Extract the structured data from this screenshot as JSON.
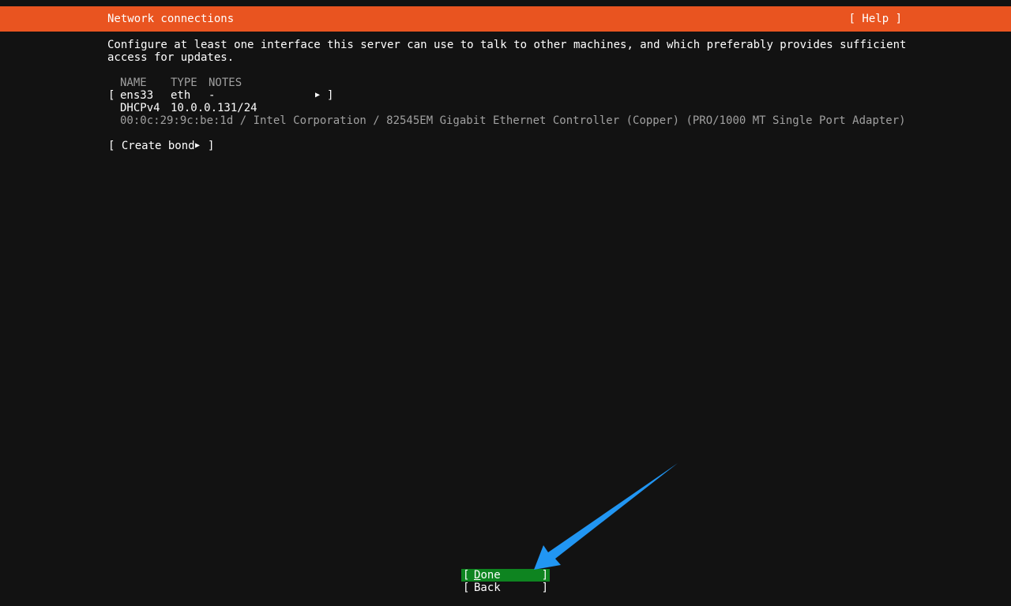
{
  "header": {
    "title": "Network connections",
    "help": "[ Help ]"
  },
  "description": {
    "line1": "Configure at least one interface this server can use to talk to other machines, and which preferably provides sufficient",
    "line2": "access for updates."
  },
  "table": {
    "columns": {
      "name": "NAME",
      "type": "TYPE",
      "notes": "NOTES"
    },
    "interface": {
      "bracket_open": "[",
      "name": "ens33",
      "type": "eth",
      "notes": "-",
      "bracket_close": "]",
      "dhcp_label": "DHCPv4",
      "address": "10.0.0.131/24",
      "hardware": "00:0c:29:9c:be:1d / Intel Corporation / 82545EM Gigabit Ethernet Controller (Copper) (PRO/1000 MT Single Port Adapter)"
    }
  },
  "create_bond": {
    "label": "[ Create bond ",
    "close": "]"
  },
  "buttons": {
    "done": {
      "first": "D",
      "rest": "one"
    },
    "back": "Back"
  },
  "colors": {
    "header_bg": "#e95420",
    "selected_button_bg": "#0e8420",
    "annotation_arrow": "#2196f3",
    "background": "#121212"
  },
  "icons": {
    "row_arrow": "▶",
    "annotation": "arrow-pointer"
  }
}
